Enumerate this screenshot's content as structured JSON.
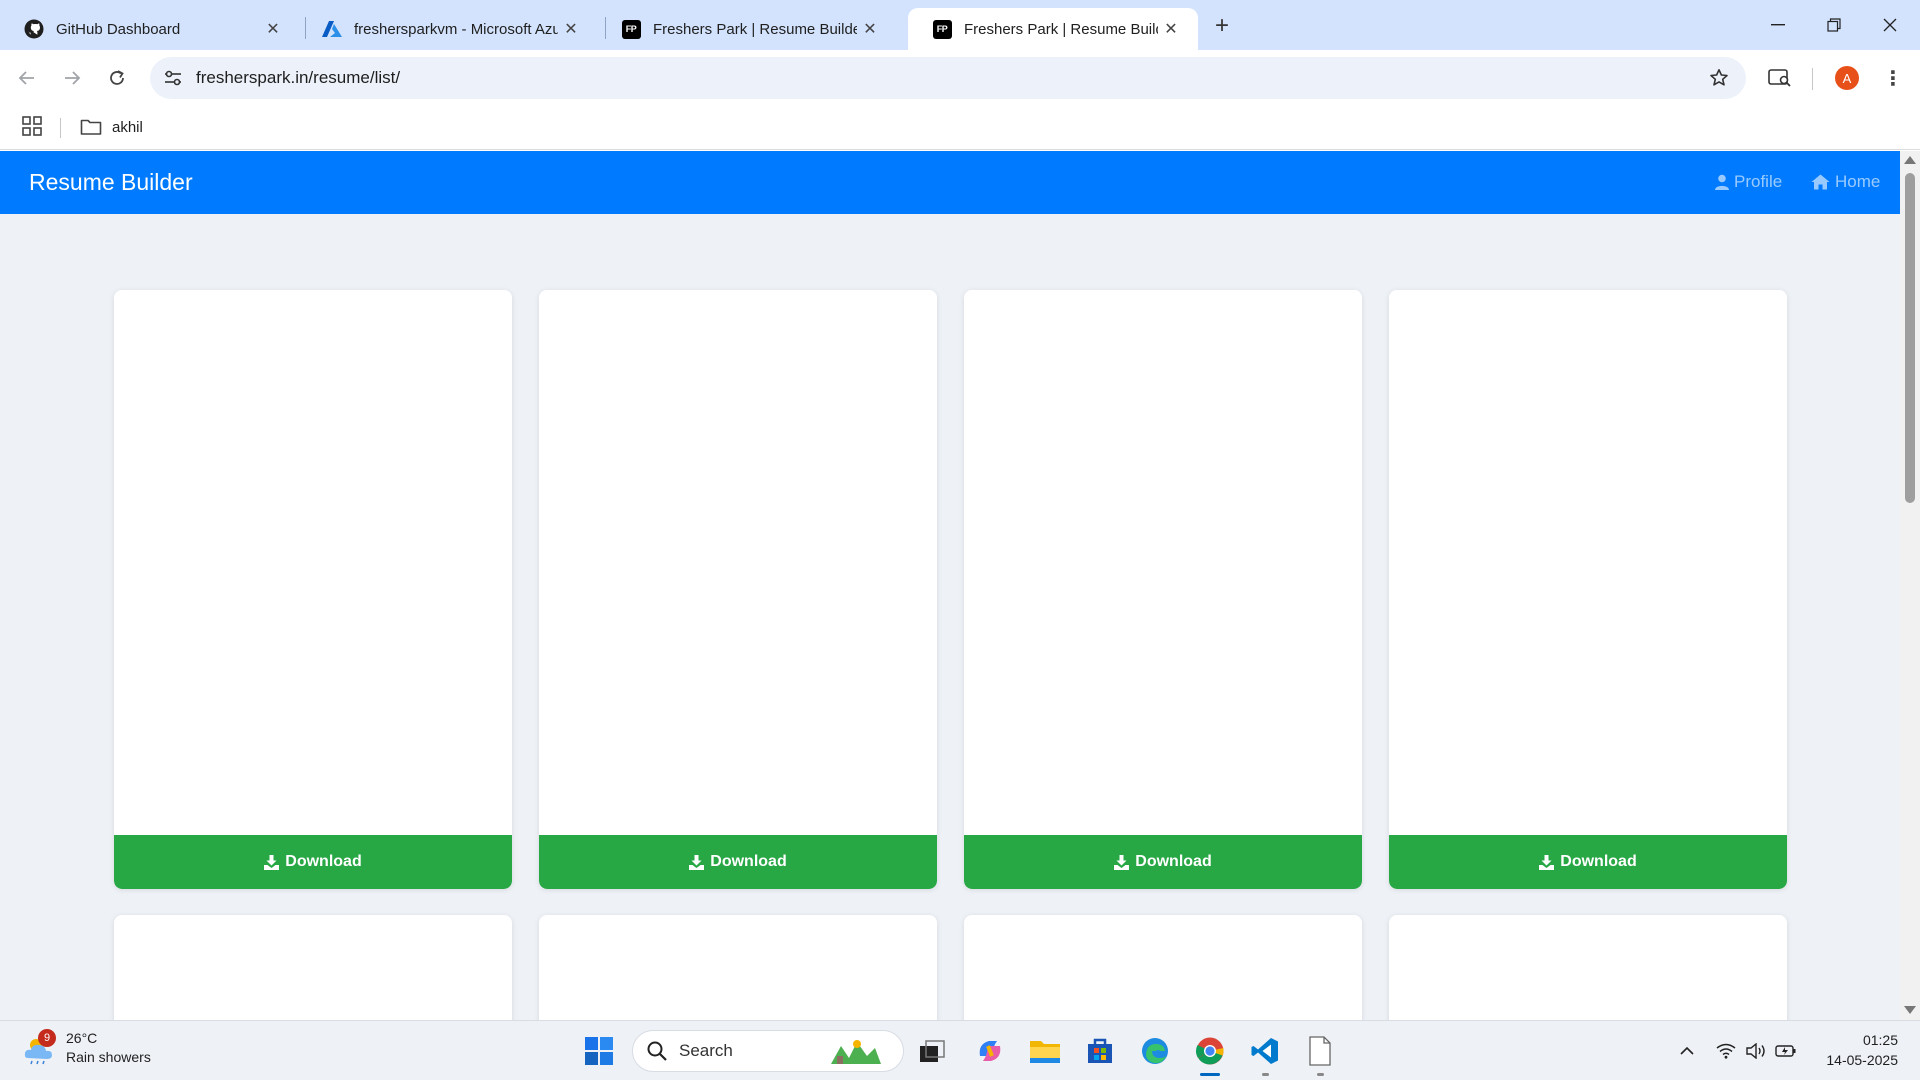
{
  "browser": {
    "tabs": [
      {
        "title": "GitHub Dashboard",
        "icon": "github-icon",
        "active": false
      },
      {
        "title": "freshersparkvm - Microsoft Azure",
        "icon": "azure-icon",
        "active": false
      },
      {
        "title": "Freshers Park | Resume Builder",
        "icon": "fp-icon",
        "active": false
      },
      {
        "title": "Freshers Park | Resume Builder",
        "icon": "fp-icon",
        "active": true
      }
    ],
    "fp_badge": "FP",
    "url": "fresherspark.in/resume/list/",
    "profile_initial": "A",
    "bookmarks": [
      {
        "label": "akhil",
        "icon": "folder-icon"
      }
    ]
  },
  "page": {
    "brand": "Resume Builder",
    "nav": [
      {
        "label": "Profile",
        "icon": "user-icon"
      },
      {
        "label": "Home",
        "icon": "home-icon"
      }
    ],
    "download_label": "Download",
    "colors": {
      "navbar": "#007bff",
      "download": "#28a745",
      "background": "#eef2f7"
    }
  },
  "taskbar": {
    "weather_temp": "26°C",
    "weather_desc": "Rain showers",
    "weather_badge": "9",
    "search_label": "Search",
    "time": "01:25",
    "date": "14-05-2025"
  }
}
